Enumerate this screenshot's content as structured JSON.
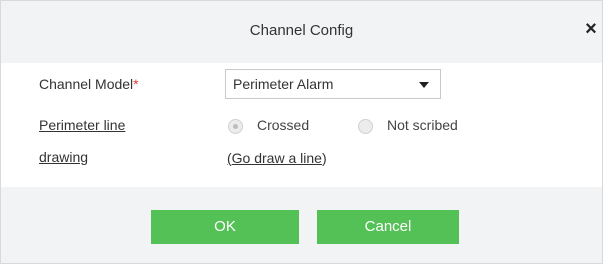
{
  "dialog": {
    "title": "Channel Config",
    "close_glyph": "×"
  },
  "form": {
    "channel_model": {
      "label": "Channel Model",
      "required_mark": "*",
      "selected_value": "Perimeter Alarm"
    },
    "perimeter": {
      "label_line1": "Perimeter line",
      "label_line2": "drawing",
      "options": [
        {
          "label": "Crossed",
          "checked": true
        },
        {
          "label": "Not scribed",
          "checked": false
        }
      ],
      "link_open": "(",
      "link_text": "Go draw a line",
      "link_close": ")"
    }
  },
  "footer": {
    "ok_label": "OK",
    "cancel_label": "Cancel"
  },
  "colors": {
    "header_bg": "#f2f3f5",
    "button_green": "#54c157",
    "required_red": "#e23b3b"
  }
}
